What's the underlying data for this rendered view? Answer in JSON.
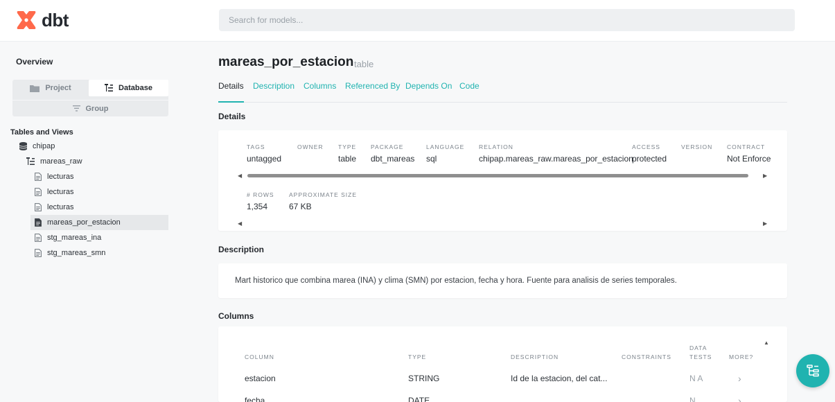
{
  "app": {
    "logo_text": "dbt",
    "brand_color": "#ff694a",
    "accent_color": "#20b3b0"
  },
  "search": {
    "placeholder": "Search for models..."
  },
  "sidebar": {
    "overview": "Overview",
    "toggle": {
      "project": "Project",
      "database": "Database",
      "group": "Group",
      "active": "Database"
    },
    "tables_title": "Tables and Views",
    "tree": [
      {
        "label": "chipap",
        "icon": "database-icon",
        "level": 0
      },
      {
        "label": "mareas_raw",
        "icon": "schema-tree-icon",
        "level": 1
      },
      {
        "label": "lecturas",
        "icon": "file-icon",
        "level": 2
      },
      {
        "label": "lecturas",
        "icon": "file-icon",
        "level": 2
      },
      {
        "label": "lecturas",
        "icon": "file-icon",
        "level": 2
      },
      {
        "label": "mareas_por_estacion",
        "icon": "file-icon",
        "level": 2,
        "active": true
      },
      {
        "label": "stg_mareas_ina",
        "icon": "file-icon",
        "level": 2
      },
      {
        "label": "stg_mareas_smn",
        "icon": "file-icon",
        "level": 2
      }
    ]
  },
  "model": {
    "name": "mareas_por_estacion",
    "kind": "table"
  },
  "tabs": [
    "Details",
    "Description",
    "Columns",
    "Referenced By",
    "Depends On",
    "Code"
  ],
  "details": {
    "title": "Details",
    "fields": [
      {
        "label": "TAGS",
        "value": "untagged"
      },
      {
        "label": "OWNER",
        "value": ""
      },
      {
        "label": "TYPE",
        "value": "table"
      },
      {
        "label": "PACKAGE",
        "value": "dbt_mareas"
      },
      {
        "label": "LANGUAGE",
        "value": "sql"
      },
      {
        "label": "RELATION",
        "value": "chipap.mareas_raw.mareas_por_estacion"
      },
      {
        "label": "ACCESS",
        "value": "protected"
      },
      {
        "label": "VERSION",
        "value": ""
      },
      {
        "label": "CONTRACT",
        "value": "Not Enforced"
      }
    ],
    "stats": [
      {
        "label": "# ROWS",
        "value": "1,354"
      },
      {
        "label": "APPROXIMATE SIZE",
        "value": "67 KB"
      }
    ]
  },
  "description": {
    "title": "Description",
    "text": "Mart historico que combina marea (INA) y clima (SMN) por estacion, fecha y hora. Fuente para analisis de series temporales."
  },
  "columns": {
    "title": "Columns",
    "headers": [
      "COLUMN",
      "TYPE",
      "DESCRIPTION",
      "CONSTRAINTS",
      "DATA TESTS",
      "MORE?"
    ],
    "rows": [
      {
        "column": "estacion",
        "type": "STRING",
        "description": "Id de la estacion, del cat...",
        "constraints": "",
        "tests": "N A",
        "more": "›"
      },
      {
        "column": "fecha",
        "type": "DATE",
        "description": "",
        "constraints": "",
        "tests": "N",
        "more": "›"
      }
    ]
  }
}
